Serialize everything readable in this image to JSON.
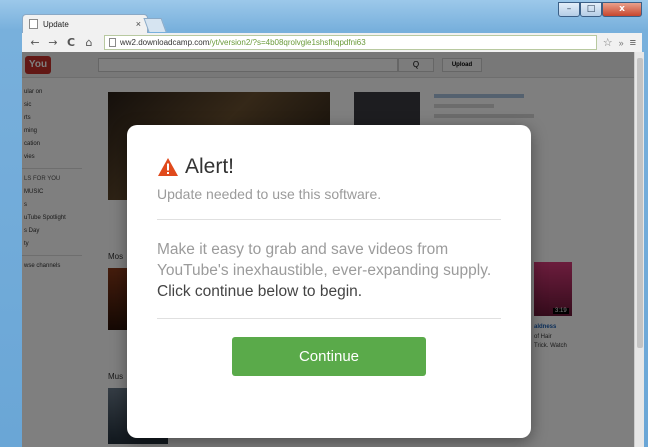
{
  "browser": {
    "tab_title": "Update",
    "tab_close": "×",
    "url_host": "ww2.downloadcamp.com",
    "url_path": "/yt/version2/?s=4b08qrolvgle1shsfhqpdfni63",
    "window_controls": {
      "minimize": "–",
      "maximize": "□",
      "close": "x"
    },
    "nav": {
      "back": "←",
      "forward": "→",
      "reload": "C",
      "home": "⌂"
    },
    "star": "☆",
    "ext": "»",
    "menu": "≡"
  },
  "youtube": {
    "logo": "You",
    "search_button": "Q",
    "upload_button": "Upload",
    "sidebar": [
      "ular on",
      "sic",
      "rts",
      "ming",
      "cation",
      "vies"
    ],
    "sidebar_section": "LS FOR YOU",
    "sidebar_channels": [
      "MUSIC",
      "s",
      "uTube Spotlight",
      "s Day",
      "ty"
    ],
    "browse": "wse channels",
    "section1": "Mos",
    "section2": "Mus",
    "duration": "3:19",
    "side_caption_1": "aldness",
    "side_caption_2": "of Hair",
    "side_caption_3": "Trick. Watch"
  },
  "alert": {
    "title": "Alert!",
    "subtitle": "Update needed to use this software.",
    "body_plain": "Make it easy to grab and save videos from YouTube's inexhaustible, ever-expanding supply.",
    "body_strong": "Click continue below to begin.",
    "button_label": "Continue"
  },
  "colors": {
    "button": "#5aaa4a",
    "warning": "#e04a1c",
    "url_path": "#6a9a3a"
  }
}
